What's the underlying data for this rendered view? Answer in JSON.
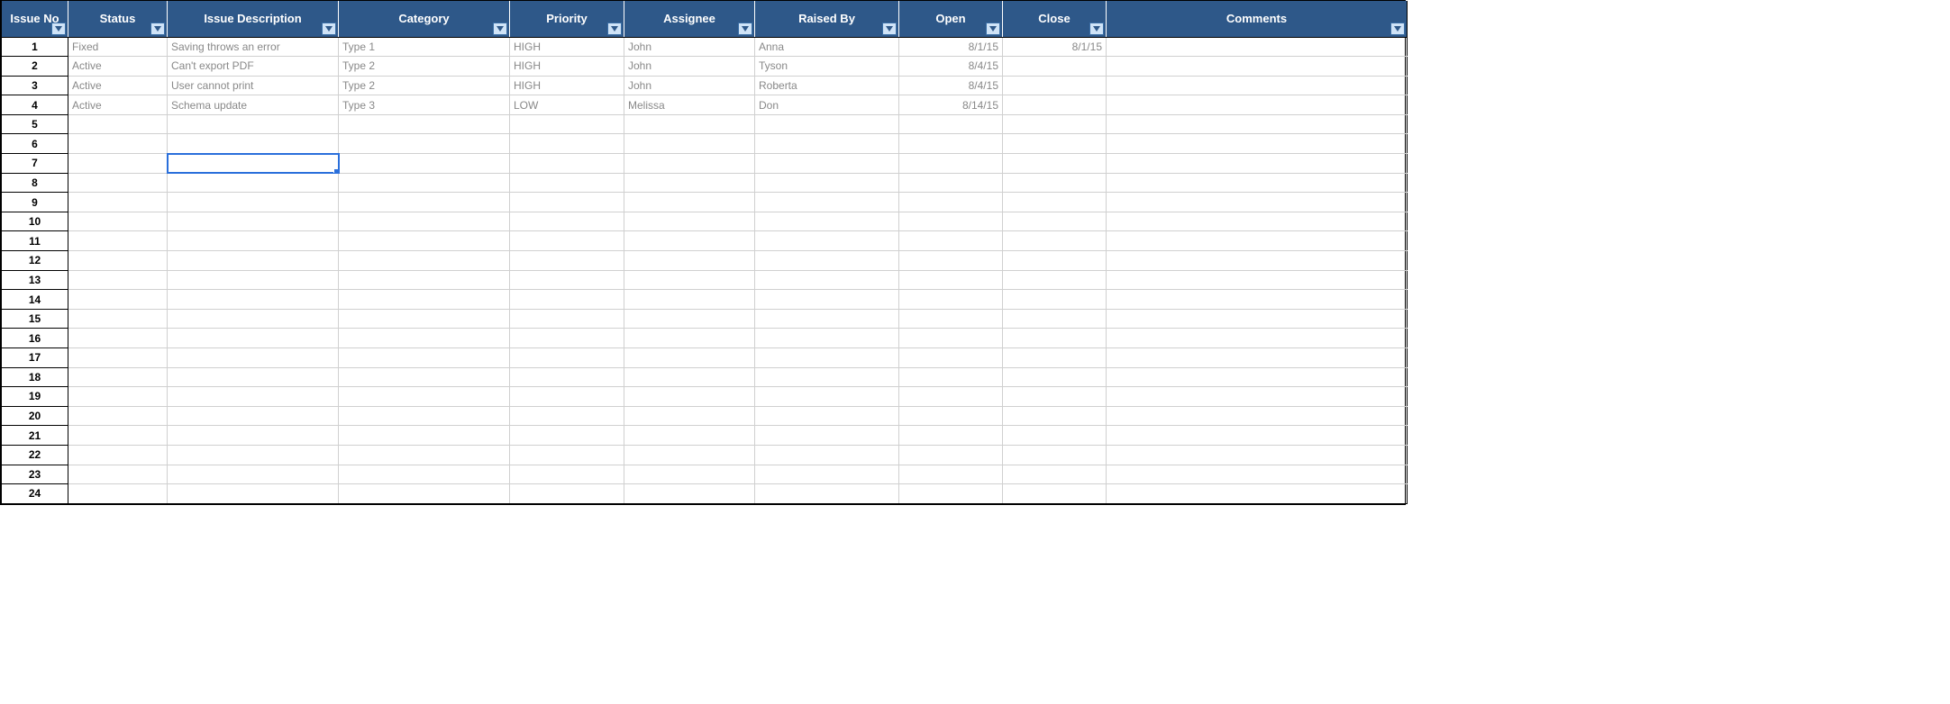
{
  "headers": {
    "issue_no": "Issue No",
    "status": "Status",
    "description": "Issue Description",
    "category": "Category",
    "priority": "Priority",
    "assignee": "Assignee",
    "raised_by": "Raised By",
    "open": "Open",
    "close": "Close",
    "comments": "Comments"
  },
  "rows": [
    {
      "no": "1",
      "status": "Fixed",
      "description": "Saving throws an error",
      "category": "Type 1",
      "priority": "HIGH",
      "assignee": "John",
      "raised_by": "Anna",
      "open": "8/1/15",
      "close": "8/1/15",
      "comments": ""
    },
    {
      "no": "2",
      "status": "Active",
      "description": "Can't export PDF",
      "category": "Type 2",
      "priority": "HIGH",
      "assignee": "John",
      "raised_by": "Tyson",
      "open": "8/4/15",
      "close": "",
      "comments": ""
    },
    {
      "no": "3",
      "status": "Active",
      "description": "User cannot print",
      "category": "Type 2",
      "priority": "HIGH",
      "assignee": "John",
      "raised_by": "Roberta",
      "open": "8/4/15",
      "close": "",
      "comments": ""
    },
    {
      "no": "4",
      "status": "Active",
      "description": "Schema update",
      "category": "Type 3",
      "priority": "LOW",
      "assignee": "Melissa",
      "raised_by": "Don",
      "open": "8/14/15",
      "close": "",
      "comments": ""
    },
    {
      "no": "5",
      "status": "",
      "description": "",
      "category": "",
      "priority": "",
      "assignee": "",
      "raised_by": "",
      "open": "",
      "close": "",
      "comments": ""
    },
    {
      "no": "6",
      "status": "",
      "description": "",
      "category": "",
      "priority": "",
      "assignee": "",
      "raised_by": "",
      "open": "",
      "close": "",
      "comments": ""
    },
    {
      "no": "7",
      "status": "",
      "description": "",
      "category": "",
      "priority": "",
      "assignee": "",
      "raised_by": "",
      "open": "",
      "close": "",
      "comments": ""
    },
    {
      "no": "8",
      "status": "",
      "description": "",
      "category": "",
      "priority": "",
      "assignee": "",
      "raised_by": "",
      "open": "",
      "close": "",
      "comments": ""
    },
    {
      "no": "9",
      "status": "",
      "description": "",
      "category": "",
      "priority": "",
      "assignee": "",
      "raised_by": "",
      "open": "",
      "close": "",
      "comments": ""
    },
    {
      "no": "10",
      "status": "",
      "description": "",
      "category": "",
      "priority": "",
      "assignee": "",
      "raised_by": "",
      "open": "",
      "close": "",
      "comments": ""
    },
    {
      "no": "11",
      "status": "",
      "description": "",
      "category": "",
      "priority": "",
      "assignee": "",
      "raised_by": "",
      "open": "",
      "close": "",
      "comments": ""
    },
    {
      "no": "12",
      "status": "",
      "description": "",
      "category": "",
      "priority": "",
      "assignee": "",
      "raised_by": "",
      "open": "",
      "close": "",
      "comments": ""
    },
    {
      "no": "13",
      "status": "",
      "description": "",
      "category": "",
      "priority": "",
      "assignee": "",
      "raised_by": "",
      "open": "",
      "close": "",
      "comments": ""
    },
    {
      "no": "14",
      "status": "",
      "description": "",
      "category": "",
      "priority": "",
      "assignee": "",
      "raised_by": "",
      "open": "",
      "close": "",
      "comments": ""
    },
    {
      "no": "15",
      "status": "",
      "description": "",
      "category": "",
      "priority": "",
      "assignee": "",
      "raised_by": "",
      "open": "",
      "close": "",
      "comments": ""
    },
    {
      "no": "16",
      "status": "",
      "description": "",
      "category": "",
      "priority": "",
      "assignee": "",
      "raised_by": "",
      "open": "",
      "close": "",
      "comments": ""
    },
    {
      "no": "17",
      "status": "",
      "description": "",
      "category": "",
      "priority": "",
      "assignee": "",
      "raised_by": "",
      "open": "",
      "close": "",
      "comments": ""
    },
    {
      "no": "18",
      "status": "",
      "description": "",
      "category": "",
      "priority": "",
      "assignee": "",
      "raised_by": "",
      "open": "",
      "close": "",
      "comments": ""
    },
    {
      "no": "19",
      "status": "",
      "description": "",
      "category": "",
      "priority": "",
      "assignee": "",
      "raised_by": "",
      "open": "",
      "close": "",
      "comments": ""
    },
    {
      "no": "20",
      "status": "",
      "description": "",
      "category": "",
      "priority": "",
      "assignee": "",
      "raised_by": "",
      "open": "",
      "close": "",
      "comments": ""
    },
    {
      "no": "21",
      "status": "",
      "description": "",
      "category": "",
      "priority": "",
      "assignee": "",
      "raised_by": "",
      "open": "",
      "close": "",
      "comments": ""
    },
    {
      "no": "22",
      "status": "",
      "description": "",
      "category": "",
      "priority": "",
      "assignee": "",
      "raised_by": "",
      "open": "",
      "close": "",
      "comments": ""
    },
    {
      "no": "23",
      "status": "",
      "description": "",
      "category": "",
      "priority": "",
      "assignee": "",
      "raised_by": "",
      "open": "",
      "close": "",
      "comments": ""
    },
    {
      "no": "24",
      "status": "",
      "description": "",
      "category": "",
      "priority": "",
      "assignee": "",
      "raised_by": "",
      "open": "",
      "close": "",
      "comments": ""
    }
  ],
  "selection": {
    "row": 7,
    "col": "description"
  }
}
